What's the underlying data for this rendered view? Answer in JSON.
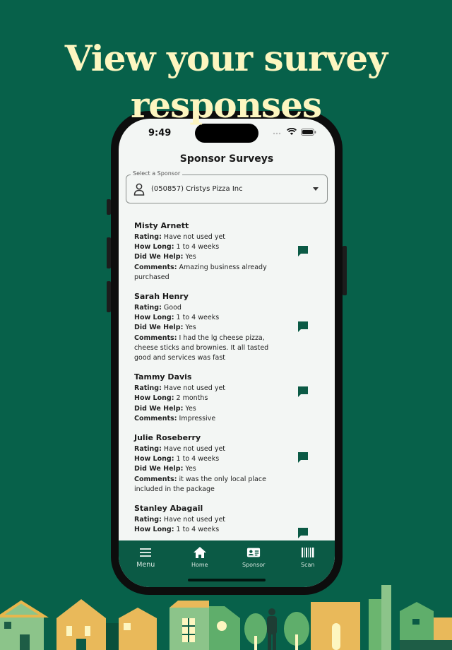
{
  "headline": {
    "line1": "View your survey",
    "line2": "responses"
  },
  "status_bar": {
    "time": "9:49"
  },
  "header": {
    "title": "Sponsor Surveys"
  },
  "sponsor_select": {
    "label": "Select a Sponsor",
    "value": "(050857) Cristys Pizza Inc"
  },
  "field_labels": {
    "rating": "Rating:",
    "how_long": "How Long:",
    "did_we_help": "Did We Help:",
    "comments": "Comments:"
  },
  "responses": [
    {
      "name": "Misty Arnett",
      "rating": "Have not used yet",
      "how_long": "1 to 4 weeks",
      "did_we_help": "Yes",
      "comments": "Amazing business already purchased"
    },
    {
      "name": "Sarah Henry",
      "rating": "Good",
      "how_long": "1 to 4 weeks",
      "did_we_help": "Yes",
      "comments": "I had the lg cheese pizza, cheese sticks and brownies. It all tasted good and services was fast"
    },
    {
      "name": "Tammy Davis",
      "rating": "Have not used yet",
      "how_long": "2 months",
      "did_we_help": "Yes",
      "comments": "Impressive"
    },
    {
      "name": "Julie Roseberry",
      "rating": "Have not used yet",
      "how_long": "1 to 4 weeks",
      "did_we_help": "Yes",
      "comments": "it was the only local place included in the package"
    },
    {
      "name": "Stanley Abagail",
      "rating": "Have not used yet",
      "how_long": "1 to 4 weeks"
    }
  ],
  "bottom_nav": [
    {
      "label": "Menu",
      "icon": "menu-icon"
    },
    {
      "label": "Home",
      "icon": "home-icon"
    },
    {
      "label": "Sponsor",
      "icon": "id-card-icon"
    },
    {
      "label": "Scan",
      "icon": "barcode-icon"
    }
  ],
  "colors": {
    "background": "#07614a",
    "headline": "#fdf6c0",
    "accent": "#0b5a45",
    "screen": "#f3f6f4"
  }
}
